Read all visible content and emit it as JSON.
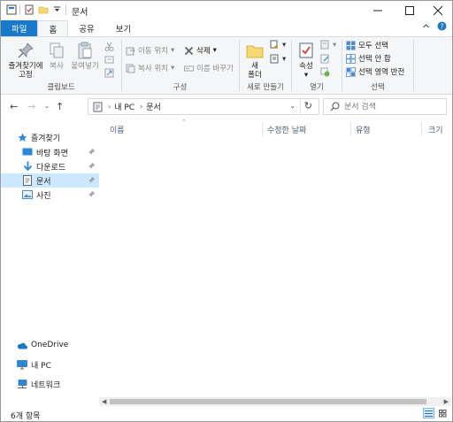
{
  "window": {
    "title": "문서"
  },
  "ribbon_tabs": {
    "file": "파일",
    "home": "홈",
    "share": "공유",
    "view": "보기"
  },
  "clipboard": {
    "pin": "즐겨찾기에\n고정",
    "copy": "복사",
    "paste": "붙여넣기",
    "label": "클립보드"
  },
  "organize": {
    "move_to": "이동 위치",
    "copy_to": "복사 위치",
    "delete": "삭제",
    "rename": "이름 바꾸기",
    "label": "구성"
  },
  "new": {
    "new_folder": "새\n폴더",
    "label": "새로 만들기"
  },
  "open": {
    "properties": "속성",
    "label": "열기"
  },
  "select": {
    "select_all": "모두 선택",
    "select_none": "선택 안 함",
    "invert": "선택 영역 반전",
    "label": "선택"
  },
  "address": {
    "root": "내 PC",
    "current": "문서"
  },
  "search": {
    "placeholder": "문서 검색"
  },
  "nav_pane": {
    "quick_access": "즐겨찾기",
    "items": [
      {
        "label": "바탕 화면"
      },
      {
        "label": "다운로드"
      },
      {
        "label": "문서"
      },
      {
        "label": "사진"
      }
    ],
    "onedrive": "OneDrive",
    "this_pc": "내 PC",
    "network": "네트워크"
  },
  "columns": {
    "name": "이름",
    "modified": "수정한 날짜",
    "type": "유형",
    "size": "크기"
  },
  "status": {
    "item_count": "6개 항목"
  },
  "colors": {
    "accent": "#1979ca",
    "selection": "#cce8ff",
    "folder": "#f8d775"
  }
}
